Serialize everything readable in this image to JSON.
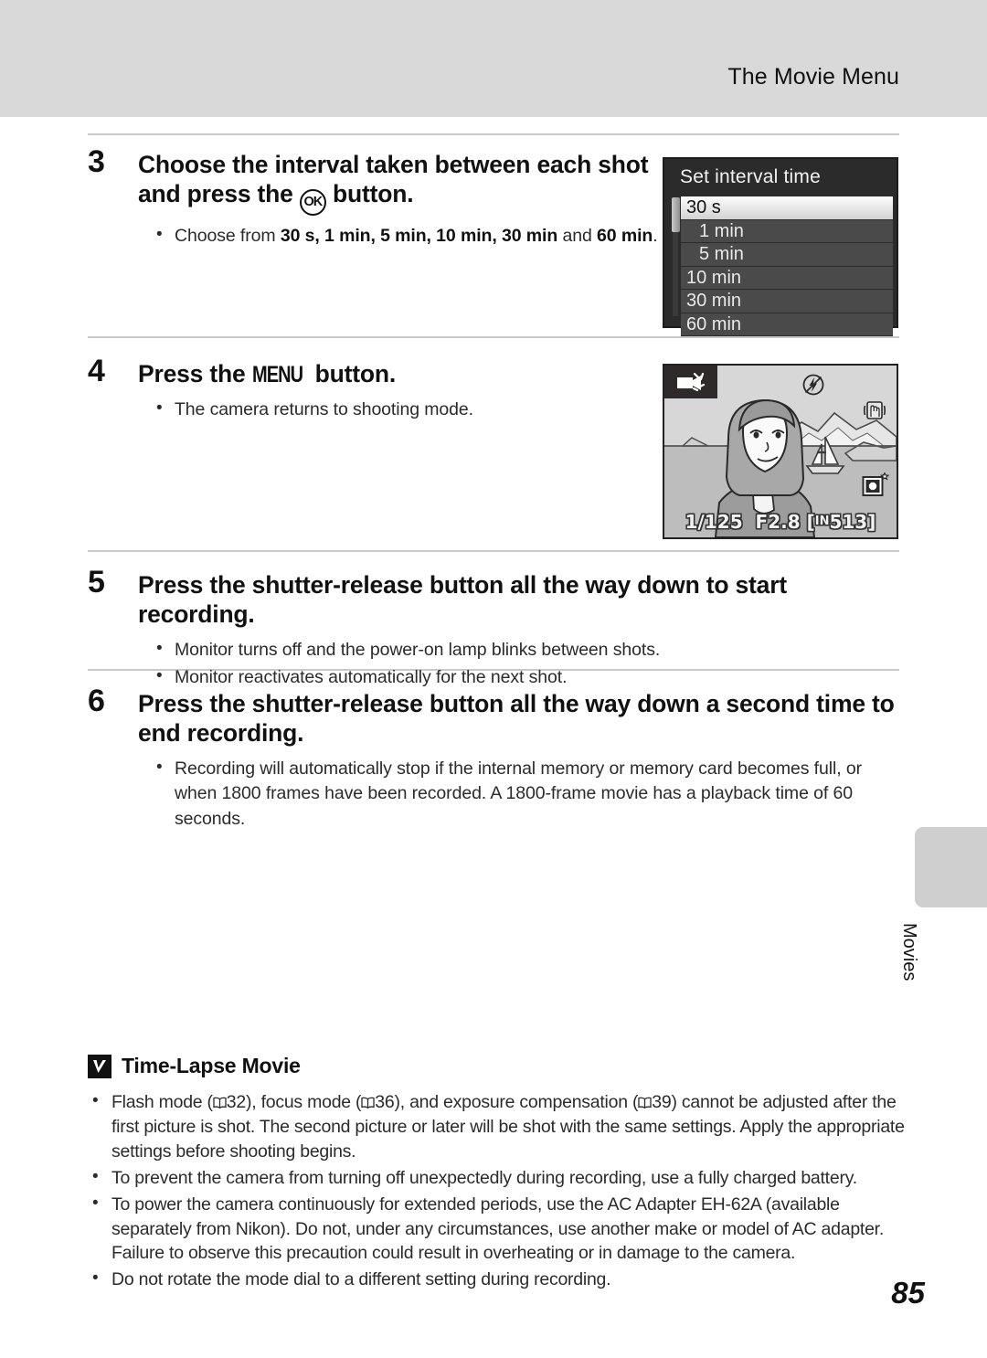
{
  "header": {
    "title": "The Movie Menu"
  },
  "steps": [
    {
      "number": "3",
      "title_pre": "Choose the interval taken between each shot and press the ",
      "title_glyph": "OK",
      "title_post": " button.",
      "bullet_pre": "Choose from ",
      "bullet_options": "30 s, 1 min, 5 min, 10 min, 30 min",
      "bullet_mid": " and ",
      "bullet_last": "60 min",
      "bullet_end": "."
    },
    {
      "number": "4",
      "title_pre": "Press the ",
      "title_glyph": "MENU",
      "title_post": " button.",
      "bullet_1": "The camera returns to shooting mode."
    },
    {
      "number": "5",
      "title": "Press the shutter-release button all the way down to start recording.",
      "bullet_1": "Monitor turns off and the power-on lamp blinks between shots.",
      "bullet_2": "Monitor reactivates automatically for the next shot."
    },
    {
      "number": "6",
      "title": "Press the shutter-release button all the way down a second time to end recording.",
      "bullet_1": "Recording will automatically stop if the internal memory or memory card becomes full, or when 1800 frames have been recorded. A 1800-frame movie has a playback time of 60 seconds."
    }
  ],
  "camera_menu": {
    "title": "Set interval time",
    "items": [
      {
        "label": "30 s",
        "selected": true,
        "indent": false
      },
      {
        "label": "1 min",
        "selected": false,
        "indent": true
      },
      {
        "label": "5 min",
        "selected": false,
        "indent": true
      },
      {
        "label": "10 min",
        "selected": false,
        "indent": false
      },
      {
        "label": "30 min",
        "selected": false,
        "indent": false
      },
      {
        "label": "60 min",
        "selected": false,
        "indent": false
      }
    ]
  },
  "camera_view": {
    "mode_icon": "movie-camera-icon",
    "flash_icon": "flash-off-icon",
    "shake_icon": "vibration-reduction-icon",
    "focus_icon": "image-mode-icon",
    "shutter_speed": "1/125",
    "aperture": "F2.8",
    "memory_label": "IN",
    "frames_remaining": "513"
  },
  "note": {
    "icon": "caution-checkmark-icon",
    "title": "Time-Lapse Movie",
    "bullets": [
      {
        "parts": [
          {
            "type": "text",
            "value": "Flash mode ("
          },
          {
            "type": "book",
            "value": "32"
          },
          {
            "type": "text",
            "value": "), focus mode ("
          },
          {
            "type": "book",
            "value": "36"
          },
          {
            "type": "text",
            "value": "), and exposure compensation ("
          },
          {
            "type": "book",
            "value": "39"
          },
          {
            "type": "text",
            "value": ") cannot be adjusted after the first picture is shot. The second picture or later will be shot with the same settings. Apply the appropriate settings before shooting begins."
          }
        ]
      },
      {
        "text": "To prevent the camera from turning off unexpectedly during recording, use a fully charged battery."
      },
      {
        "text": "To power the camera continuously for extended periods, use the AC Adapter EH-62A (available separately from Nikon). Do not, under any circumstances, use another make or model of AC adapter. Failure to observe this precaution could result in overheating or in damage to the camera."
      },
      {
        "text": "Do not rotate the mode dial to a different setting during recording."
      }
    ]
  },
  "side_tab": {
    "label": "Movies"
  },
  "page_number": "85"
}
